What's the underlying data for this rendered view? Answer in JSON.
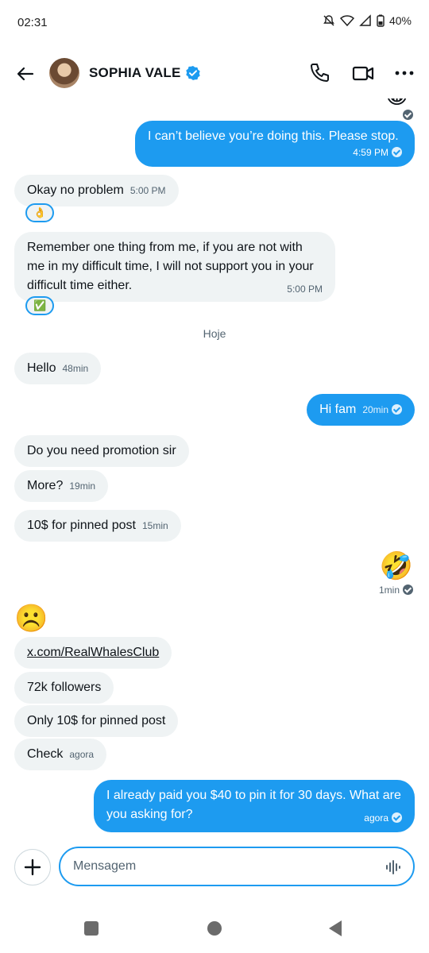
{
  "status": {
    "time": "02:31",
    "battery": "40%"
  },
  "header": {
    "contact_name": "SOPHIA VALE",
    "icons": [
      "back-arrow-icon",
      "verified-badge-icon",
      "phone-icon",
      "video-icon",
      "more-icon"
    ]
  },
  "messages": {
    "m1": {
      "text": "I can’t believe you’re doing this. Please stop.",
      "time": "4:59 PM"
    },
    "m2": {
      "text": "Okay no problem",
      "time": "5:00 PM",
      "reaction": "👌"
    },
    "m3": {
      "text": "Remember one thing from me, if you are not with me in my difficult time, I will not support you in your difficult time either.",
      "time": "5:00 PM",
      "reaction": "✅"
    },
    "day_separator": "Hoje",
    "m4": {
      "text": "Hello",
      "time": "48min"
    },
    "m5": {
      "text": "Hi fam",
      "time": "20min"
    },
    "m6": {
      "text": "Do you need promotion sir"
    },
    "m7": {
      "text": "More?",
      "time": "19min"
    },
    "m8": {
      "text": "10$ for pinned post",
      "time": "15min"
    },
    "m9": {
      "emoji": "🤣",
      "time": "1min"
    },
    "m10": {
      "emoji": "☹️"
    },
    "m11": {
      "text": "x.com/RealWhalesClub"
    },
    "m12": {
      "text": "72k followers"
    },
    "m13": {
      "text": "Only 10$ for pinned post"
    },
    "m14": {
      "text": "Check",
      "time": "agora"
    },
    "m15": {
      "text": "I already paid you $40 to pin it for 30 days. What are you asking for?",
      "time": "agora"
    }
  },
  "composer": {
    "placeholder": "Mensagem"
  },
  "colors": {
    "accent": "#1d9bf0",
    "incoming_bubble": "#eff3f4",
    "secondary_text": "#536471"
  }
}
